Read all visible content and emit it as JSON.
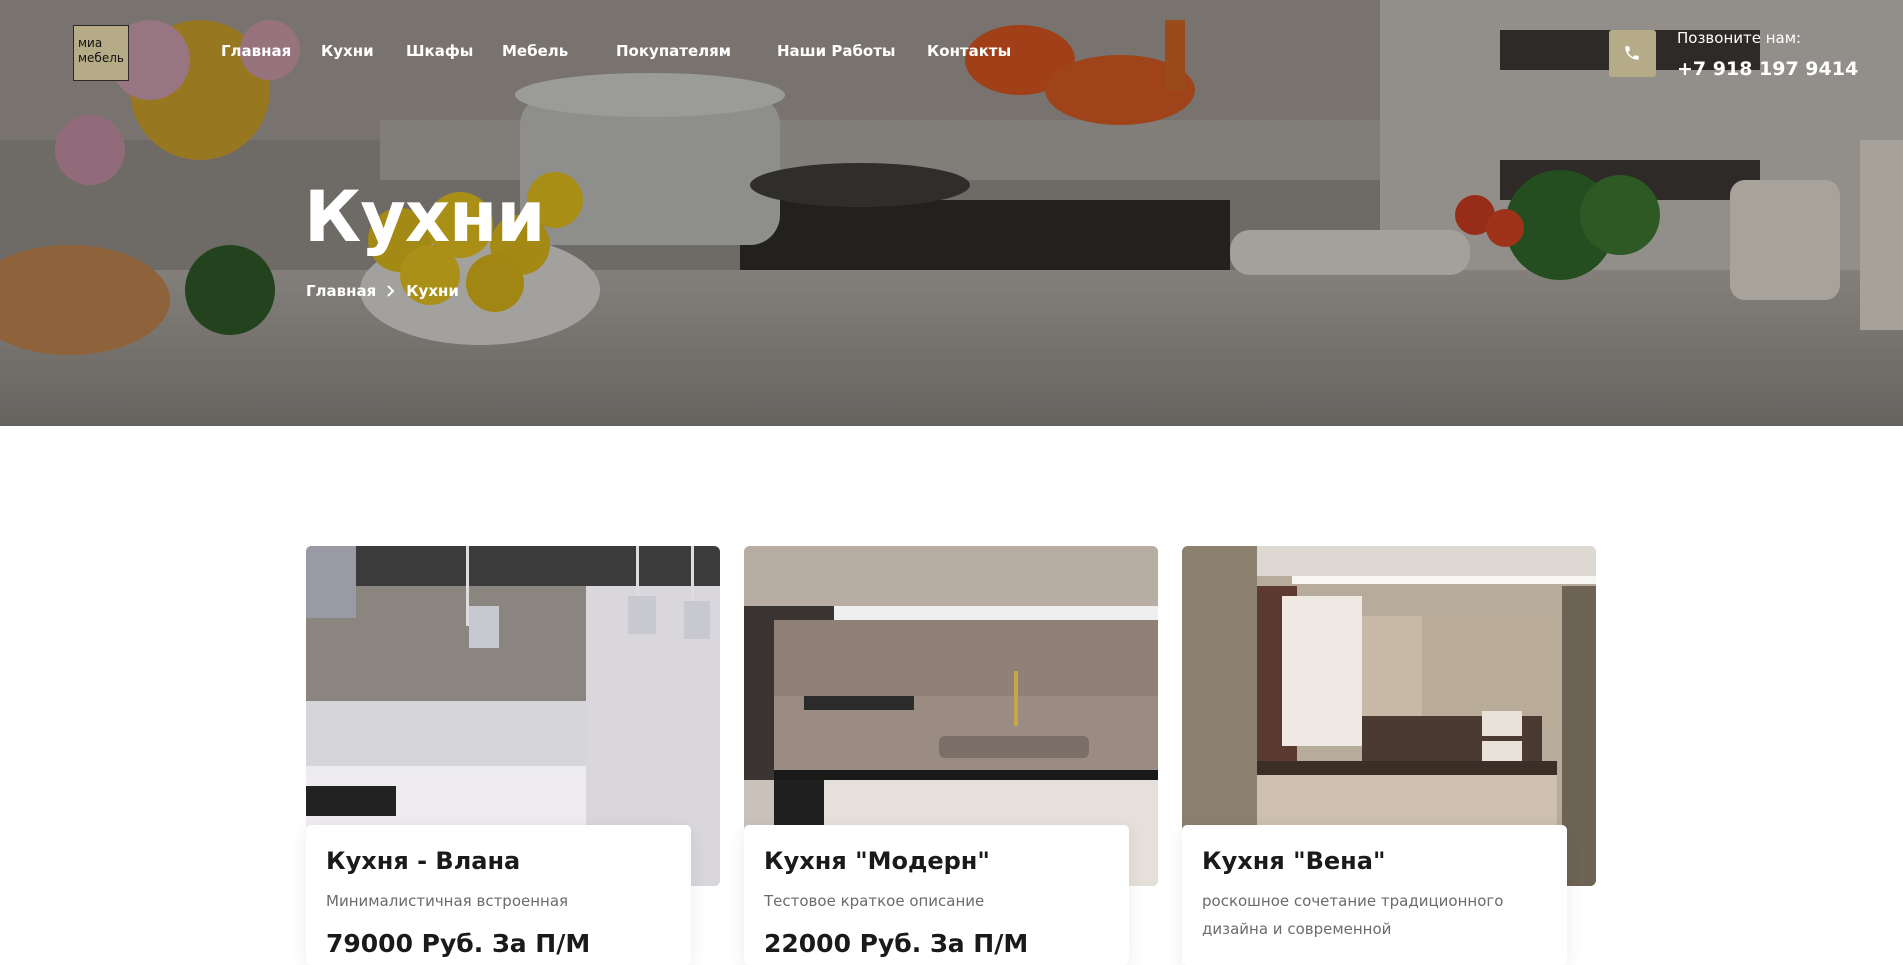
{
  "logo": {
    "line1": "миа",
    "line2": "мебель"
  },
  "nav": [
    {
      "label": "Главная"
    },
    {
      "label": "Кухни"
    },
    {
      "label": "Шкафы"
    },
    {
      "label": "Мебель"
    },
    {
      "label": "Покупателям"
    },
    {
      "label": "Наши Работы"
    },
    {
      "label": "Контакты"
    }
  ],
  "contact": {
    "label": "Позвоните нам:",
    "phone": "+7 918 197 9414",
    "icon": "phone-icon"
  },
  "hero": {
    "title": "Кухни",
    "breadcrumb": {
      "home": "Главная",
      "current": "Кухни"
    }
  },
  "products": [
    {
      "name": "Кухня - Влана",
      "description": "Минималистичная встроенная",
      "price": "79000 Руб. За П/М"
    },
    {
      "name": "Кухня \"Модерн\"",
      "description": "Тестовое краткое описание",
      "price": "22000 Руб. За П/М"
    },
    {
      "name": "Кухня \"Вена\"",
      "description": "роскошное сочетание традиционного дизайна и современной",
      "price": ""
    }
  ],
  "colors": {
    "accent": "#b5ab86",
    "text": "#1a1a1a",
    "muted": "#6b6b6b"
  }
}
